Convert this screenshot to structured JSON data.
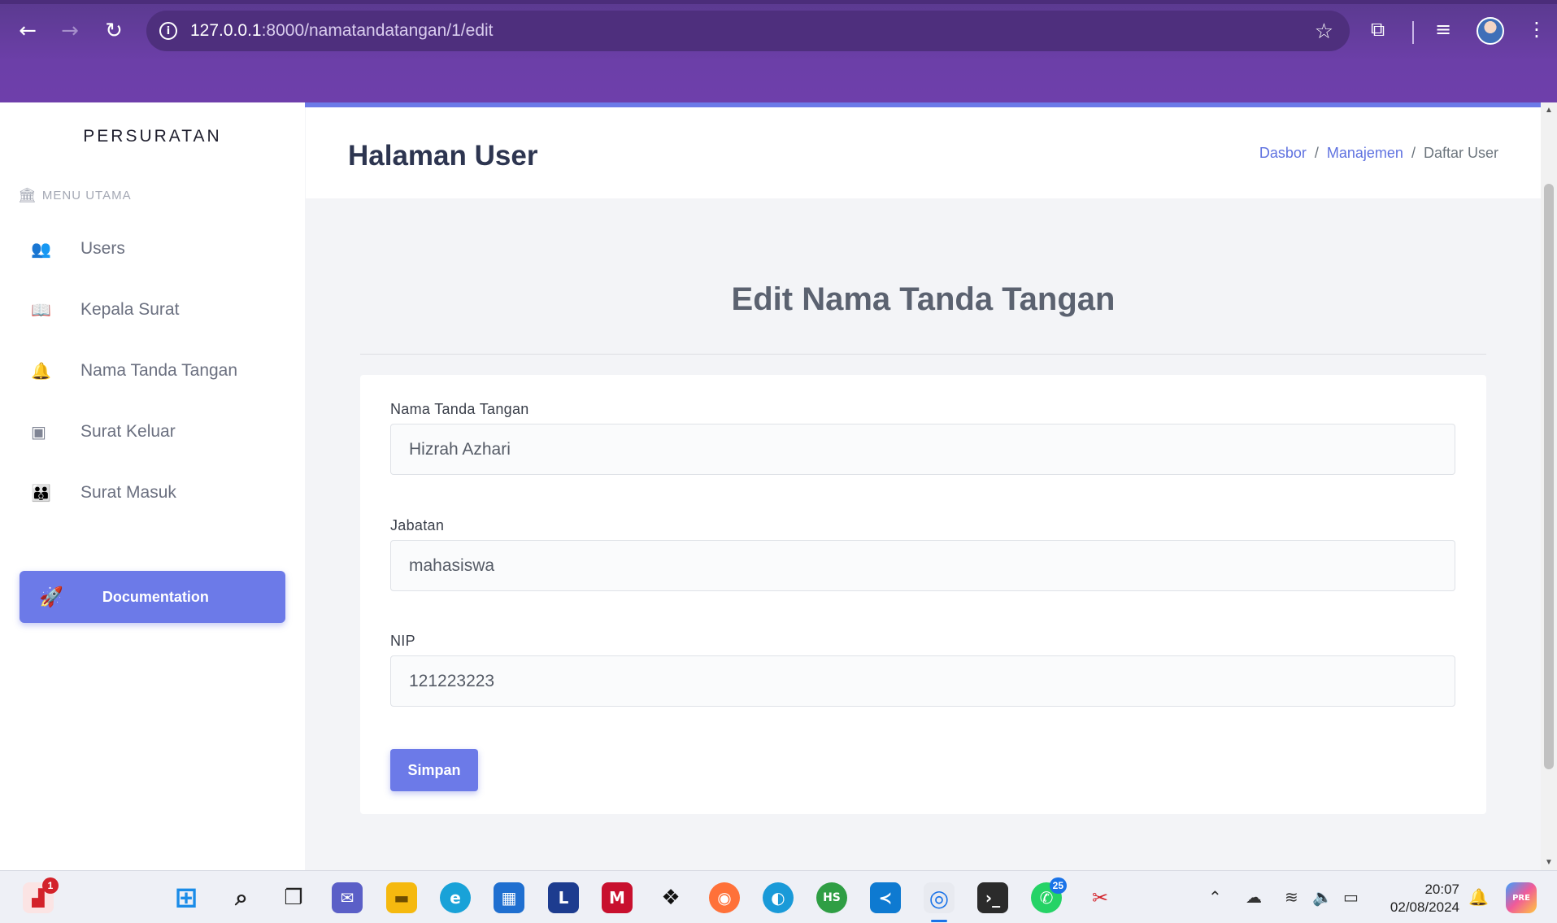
{
  "browser": {
    "url_host": "127.0.0.1",
    "url_path": ":8000/namatandatangan/1/edit"
  },
  "sidebar": {
    "brand": "PERSURATAN",
    "menu_heading": "MENU UTAMA",
    "items": [
      {
        "label": "Users",
        "icon": "users-icon"
      },
      {
        "label": "Kepala Surat",
        "icon": "book-icon"
      },
      {
        "label": "Nama Tanda Tangan",
        "icon": "bell-icon"
      },
      {
        "label": "Surat Keluar",
        "icon": "chalkboard-user-icon"
      },
      {
        "label": "Surat Masuk",
        "icon": "user-group-icon"
      }
    ],
    "documentation_label": "Documentation"
  },
  "header": {
    "title": "Halaman User",
    "breadcrumb": [
      "Dasbor",
      "Manajemen",
      "Daftar User"
    ]
  },
  "form": {
    "heading": "Edit Nama Tanda Tangan",
    "fields": [
      {
        "label": "Nama Tanda Tangan",
        "value": "Hizrah Azhari"
      },
      {
        "label": "Jabatan",
        "value": "mahasiswa"
      },
      {
        "label": "NIP",
        "value": "121223223"
      }
    ],
    "submit_label": "Simpan"
  },
  "taskbar": {
    "time": "20:07",
    "date": "02/08/2024",
    "badges": {
      "app_notify": "1",
      "whatsapp": "25"
    },
    "letter_app": "L",
    "hs_app": "HS"
  },
  "colors": {
    "accent": "#6c7ae8",
    "browser_frame": "#6c3fa8",
    "link": "#5f72e0"
  }
}
